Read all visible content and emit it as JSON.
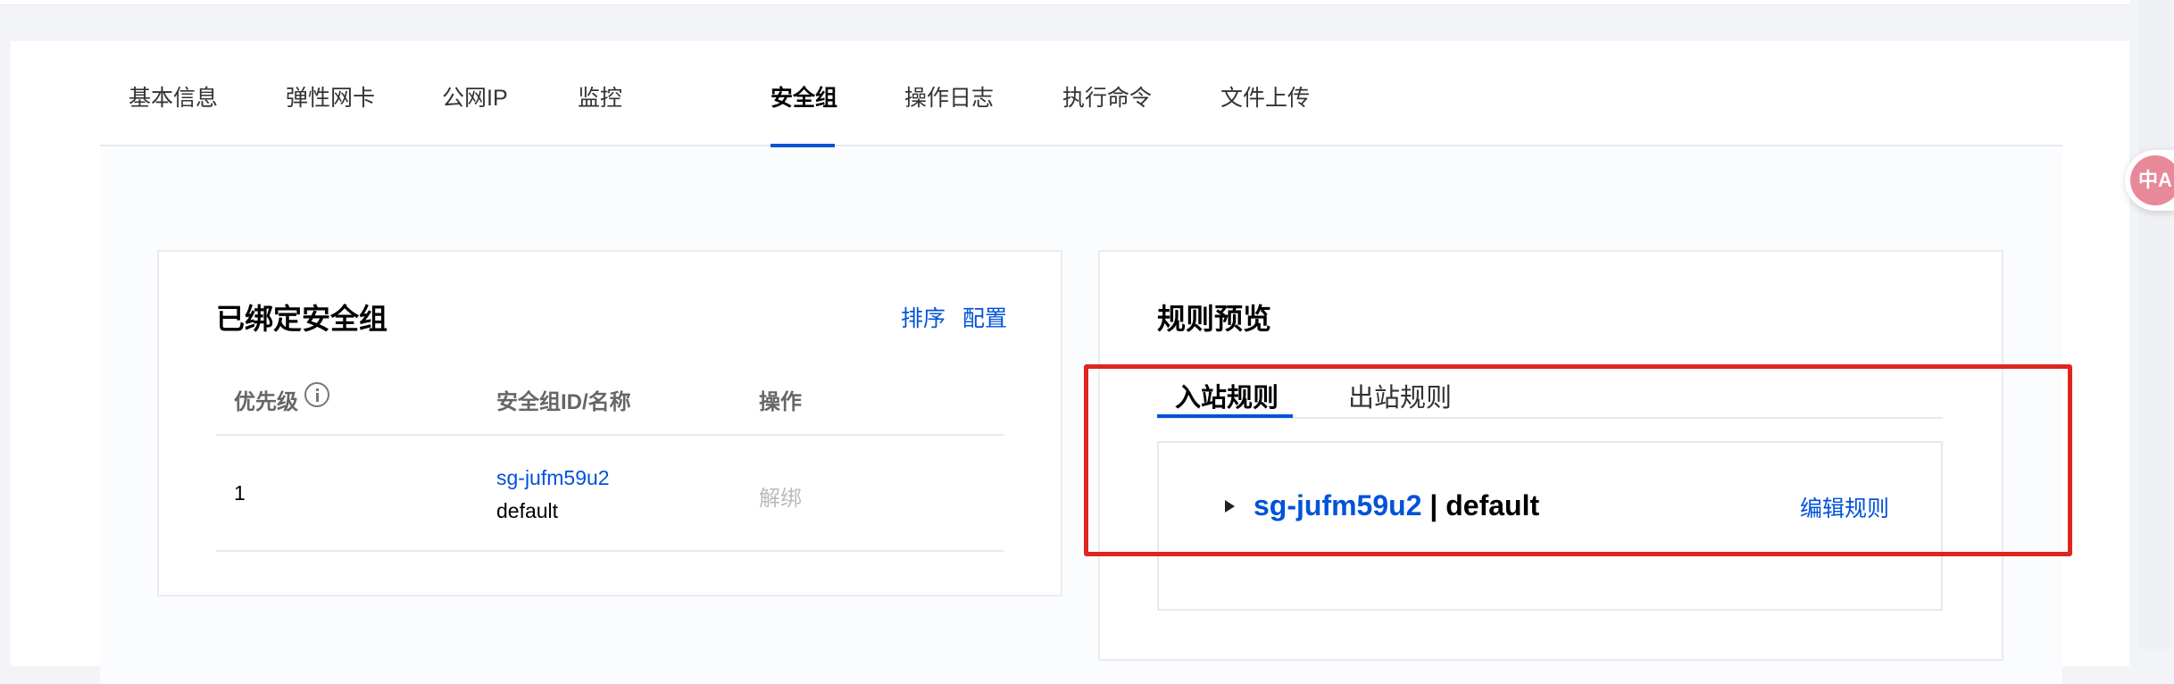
{
  "tabs": [
    {
      "label": "基本信息"
    },
    {
      "label": "弹性网卡"
    },
    {
      "label": "公网IP"
    },
    {
      "label": "监控"
    },
    {
      "label": "安全组",
      "active": true
    },
    {
      "label": "操作日志"
    },
    {
      "label": "执行命令"
    },
    {
      "label": "文件上传"
    }
  ],
  "bound_panel": {
    "title": "已绑定安全组",
    "actions": {
      "sort": "排序",
      "config": "配置"
    },
    "columns": {
      "priority": "优先级",
      "sg_id_name": "安全组ID/名称",
      "operation": "操作"
    },
    "rows": [
      {
        "priority": "1",
        "sg_id": "sg-jufm59u2",
        "sg_name": "default",
        "action": "解绑"
      }
    ]
  },
  "rules_panel": {
    "title": "规则预览",
    "subtabs": {
      "inbound": "入站规则",
      "outbound": "出站规则"
    },
    "group": {
      "sg_id": "sg-jufm59u2",
      "separator": " | ",
      "sg_name": "default",
      "edit": "编辑规则"
    }
  },
  "translate_icon_text": "中A",
  "colors": {
    "accent": "#0052d9",
    "highlight": "#e0251e"
  }
}
